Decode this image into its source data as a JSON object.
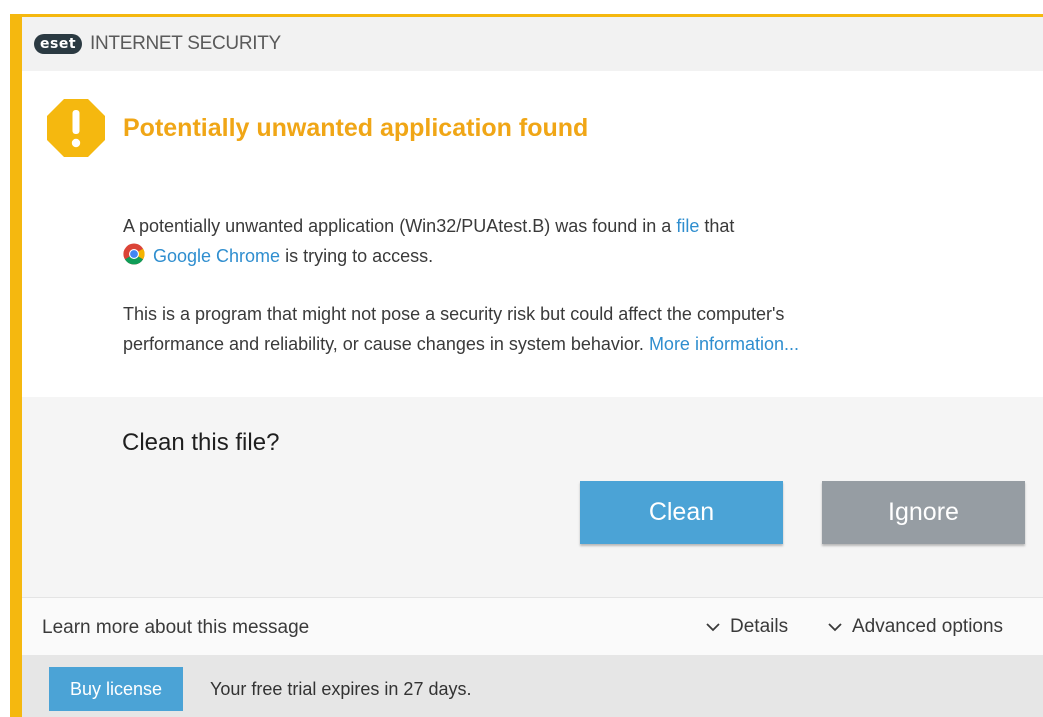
{
  "app": {
    "logo_text": "eset",
    "product_name": "INTERNET SECURITY"
  },
  "colors": {
    "accent": "#f5b80f",
    "title": "#f0a616",
    "link": "#2f8ecf",
    "primary_button": "#4ba3d6",
    "secondary_button": "#969da3"
  },
  "alert": {
    "icon": "warning-octagon-icon",
    "title": "Potentially unwanted application found",
    "message_part1": "A potentially unwanted application (Win32/PUAtest.B) was found in a ",
    "file_link": "file",
    "message_part2": " that",
    "app_icon": "google-chrome-icon",
    "app_link": "Google Chrome",
    "message_part3": " is trying to access.",
    "description_line1": "This is a program that might not pose a security risk but could affect the computer's",
    "description_line2": "performance and reliability, or cause changes in system behavior. ",
    "more_info_link": "More information..."
  },
  "prompt": {
    "question": "Clean this file?",
    "clean_label": "Clean",
    "ignore_label": "Ignore"
  },
  "footer": {
    "learn_more": "Learn more about this message",
    "details_label": "Details",
    "advanced_label": "Advanced options"
  },
  "license_bar": {
    "buy_label": "Buy license",
    "trial_text": "Your free trial expires in 27 days."
  }
}
